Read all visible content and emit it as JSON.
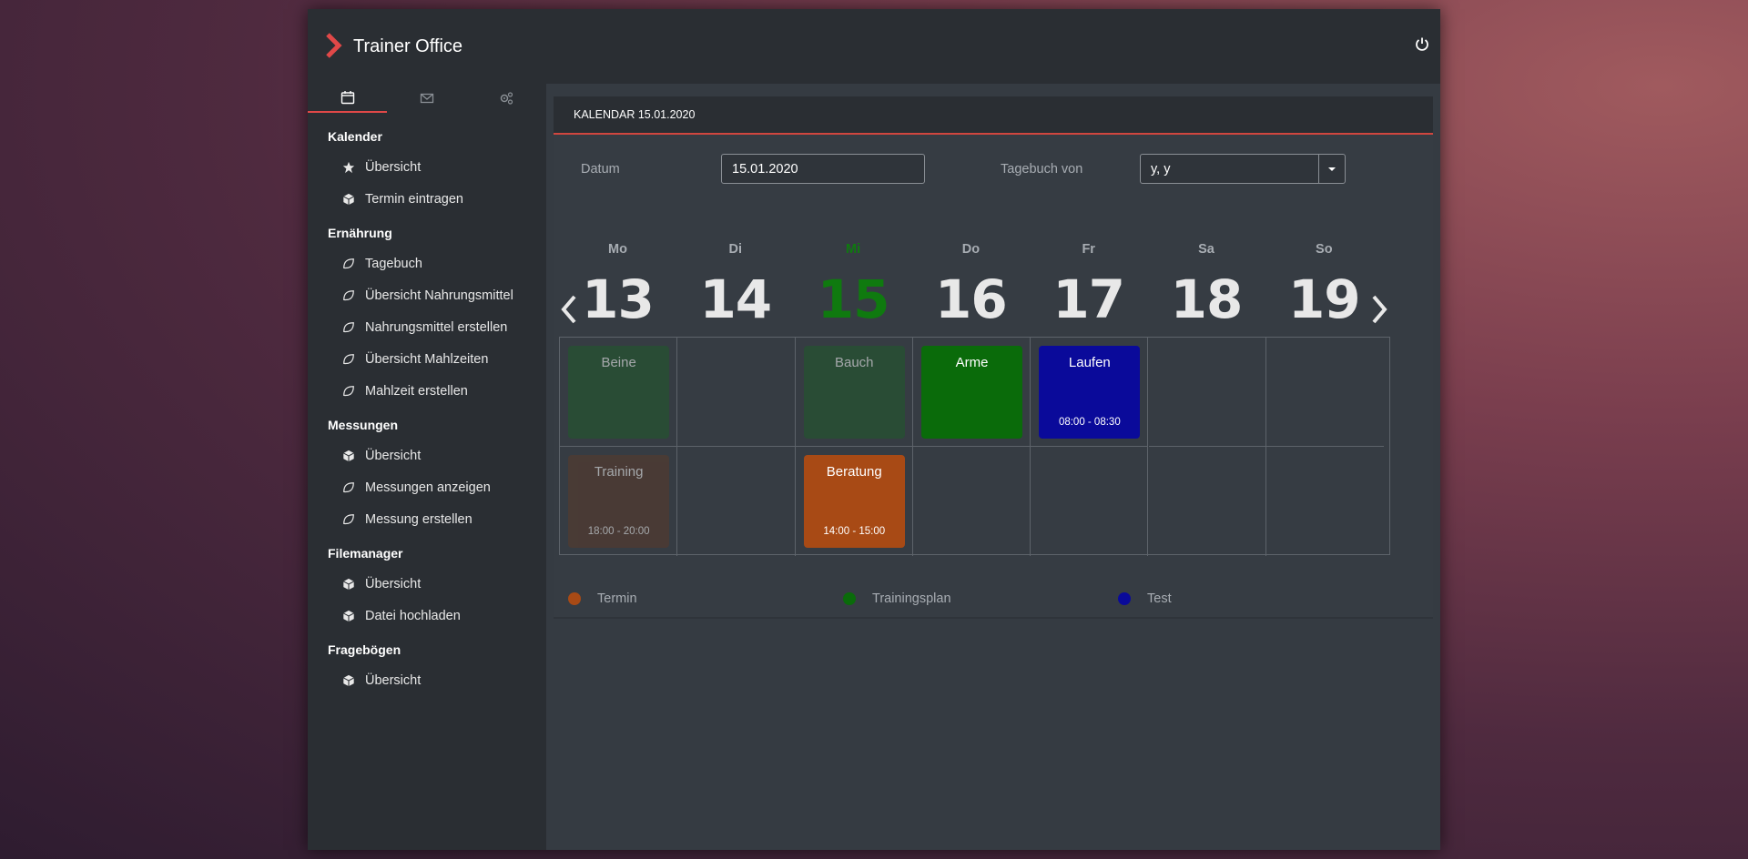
{
  "app": {
    "title": "Trainer Office"
  },
  "sidebar": {
    "tabs": [
      {
        "icon": "calendar-icon",
        "active": true
      },
      {
        "icon": "mail-icon",
        "active": false
      },
      {
        "icon": "gears-icon",
        "active": false
      }
    ],
    "sections": [
      {
        "heading": "Kalender",
        "items": [
          {
            "label": "Übersicht",
            "icon": "star-icon"
          },
          {
            "label": "Termin eintragen",
            "icon": "cube-icon"
          }
        ]
      },
      {
        "heading": "Ernährung",
        "items": [
          {
            "label": "Tagebuch",
            "icon": "leaf-icon"
          },
          {
            "label": "Übersicht Nahrungsmittel",
            "icon": "leaf-icon"
          },
          {
            "label": "Nahrungsmittel erstellen",
            "icon": "leaf-icon"
          },
          {
            "label": "Übersicht Mahlzeiten",
            "icon": "leaf-icon"
          },
          {
            "label": "Mahlzeit erstellen",
            "icon": "leaf-icon"
          }
        ]
      },
      {
        "heading": "Messungen",
        "items": [
          {
            "label": "Übersicht",
            "icon": "cube-icon"
          },
          {
            "label": "Messungen anzeigen",
            "icon": "leaf-icon"
          },
          {
            "label": "Messung erstellen",
            "icon": "leaf-icon"
          }
        ]
      },
      {
        "heading": "Filemanager",
        "items": [
          {
            "label": "Übersicht",
            "icon": "cube-icon"
          },
          {
            "label": "Datei hochladen",
            "icon": "cube-icon"
          }
        ]
      },
      {
        "heading": "Fragebögen",
        "items": [
          {
            "label": "Übersicht",
            "icon": "cube-icon"
          }
        ]
      }
    ]
  },
  "calendar": {
    "header": "KALENDAR 15.01.2020",
    "date_label": "Datum",
    "date_value": "15.01.2020",
    "diary_label": "Tagebuch von",
    "diary_value": "y, y",
    "days": [
      {
        "name": "Mo",
        "num": "13",
        "today": false
      },
      {
        "name": "Di",
        "num": "14",
        "today": false
      },
      {
        "name": "Mi",
        "num": "15",
        "today": true
      },
      {
        "name": "Do",
        "num": "16",
        "today": false
      },
      {
        "name": "Fr",
        "num": "17",
        "today": false
      },
      {
        "name": "Sa",
        "num": "18",
        "today": false
      },
      {
        "name": "So",
        "num": "19",
        "today": false
      }
    ],
    "events": [
      {
        "day": 0,
        "row": 0,
        "title": "Beine",
        "time": "",
        "color": "#1f5a2a",
        "faded": true
      },
      {
        "day": 2,
        "row": 0,
        "title": "Bauch",
        "time": "",
        "color": "#1f5a2a",
        "faded": true
      },
      {
        "day": 3,
        "row": 0,
        "title": "Arme",
        "time": "",
        "color": "#0a6b0a",
        "faded": false
      },
      {
        "day": 4,
        "row": 0,
        "title": "Laufen",
        "time": "08:00 - 08:30",
        "color": "#0a0a9a",
        "faded": false
      },
      {
        "day": 0,
        "row": 1,
        "title": "Training",
        "time": "18:00 - 20:00",
        "color": "#5a3a2a",
        "faded": true
      },
      {
        "day": 2,
        "row": 1,
        "title": "Beratung",
        "time": "14:00 - 15:00",
        "color": "#a84a15",
        "faded": false
      }
    ],
    "legend": [
      {
        "label": "Termin",
        "color": "#a84a15"
      },
      {
        "label": "Trainingsplan",
        "color": "#0a6b0a"
      },
      {
        "label": "Test",
        "color": "#0a0a9a"
      }
    ]
  }
}
